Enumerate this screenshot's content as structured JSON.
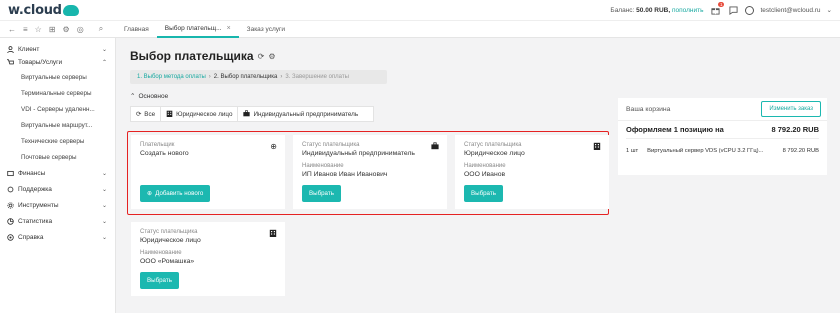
{
  "header": {
    "logo": "w.cloud",
    "balance_label": "Баланс:",
    "balance_value": "50.00 RUB,",
    "topup_link": "пополнить",
    "user_email": "testclient@wcloud.ru",
    "notifications_badge": "1"
  },
  "tabs": [
    {
      "label": "Главная"
    },
    {
      "label": "Выбор плательщ...",
      "active": true
    },
    {
      "label": "Заказ услуги"
    }
  ],
  "sidebar": {
    "items": [
      {
        "label": "Клиент",
        "icon": "user-icon"
      },
      {
        "label": "Товары/Услуги",
        "icon": "cart-icon"
      },
      {
        "label": "Финансы",
        "icon": "wallet-icon"
      },
      {
        "label": "Поддержка",
        "icon": "support-icon"
      },
      {
        "label": "Инструменты",
        "icon": "gear-icon"
      },
      {
        "label": "Статистика",
        "icon": "chart-icon"
      },
      {
        "label": "Справка",
        "icon": "help-icon"
      }
    ],
    "subitems": [
      "Виртуальные серверы",
      "Терминальные серверы",
      "VDI - Серверы удаленн...",
      "Виртуальные маршрут...",
      "Технические серверы",
      "Почтовые серверы"
    ]
  },
  "page": {
    "title": "Выбор плательщика",
    "steps": [
      "1. Выбор метода оплаты",
      "2. Выбор плательщика",
      "3. Завершение оплаты"
    ],
    "section": "Основное",
    "filters": [
      "Все",
      "Юридическое лицо",
      "Индивидуальный предприниматель"
    ]
  },
  "cards": [
    {
      "l1": "Плательщик",
      "v1": "Создать нового",
      "button": "Добавить нового"
    },
    {
      "l1": "Статус плательщика",
      "v1": "Индивидуальный предприниматель",
      "l2": "Наименование",
      "v2": "ИП Иванов Иван Иванович",
      "button": "Выбрать"
    },
    {
      "l1": "Статус плательщика",
      "v1": "Юридическое лицо",
      "l2": "Наименование",
      "v2": "ООО Иванов",
      "button": "Выбрать"
    },
    {
      "l1": "Статус плательщика",
      "v1": "Юридическое лицо",
      "l2": "Наименование",
      "v2": "ООО «Ромашка»",
      "button": "Выбрать"
    }
  ],
  "cart": {
    "title": "Ваша корзина",
    "change_button": "Изменить заказ",
    "summary": "Оформляем 1 позицию на",
    "total": "8 792.20 RUB",
    "item_qty": "1 шт",
    "item_name": "Виртуальный сервер VDS (vCPU 3.2 ГГц)...",
    "item_price": "8 792.20 RUB"
  },
  "colors": {
    "accent": "#1cb8b0",
    "highlight": "#e52222"
  }
}
